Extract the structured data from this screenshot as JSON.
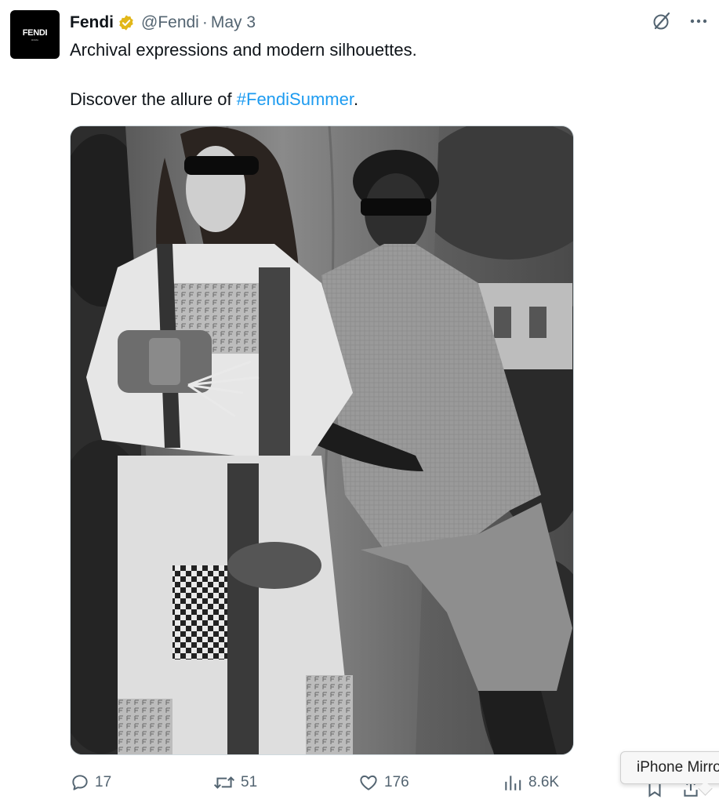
{
  "account": {
    "avatar_logo": "FENDI",
    "avatar_sub": "ROMA",
    "name": "Fendi",
    "handle": "@Fendi",
    "separator": "·",
    "date": "May 3",
    "verified_color": "#E2B719"
  },
  "tweet": {
    "line1": "Archival expressions and modern silhouettes.",
    "line2_prefix": "Discover the allure of ",
    "hashtag": "#FendiSummer",
    "line2_suffix": "."
  },
  "media": {
    "alt": "Black-and-white photo of two models leaning against a tree trunk, one in a patterned Fendi outfit holding a bag, the other in a linen shirt and shorts, both wearing sunglasses"
  },
  "actions": {
    "replies": "17",
    "reposts": "51",
    "likes": "176",
    "views": "8.6K"
  },
  "tooltip": {
    "text": "iPhone Mirroring"
  },
  "colors": {
    "text": "#0f1419",
    "muted": "#536471",
    "link": "#1d9bf0"
  }
}
